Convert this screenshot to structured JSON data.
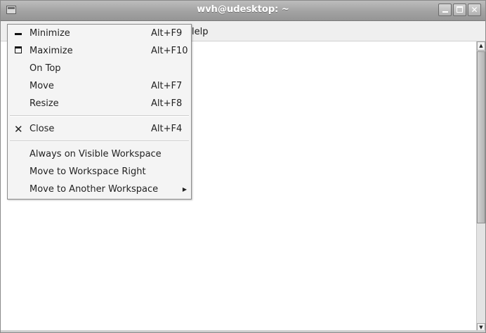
{
  "window": {
    "title": "wvh@udesktop: ~"
  },
  "menubar": {
    "visible_item": "lelp"
  },
  "window_menu": {
    "items": [
      {
        "label": "Minimize",
        "accel": "Alt+F9",
        "icon": "minimize-icon"
      },
      {
        "label": "Maximize",
        "accel": "Alt+F10",
        "icon": "maximize-icon"
      },
      {
        "label": "On Top",
        "accel": ""
      },
      {
        "label": "Move",
        "accel": "Alt+F7"
      },
      {
        "label": "Resize",
        "accel": "Alt+F8"
      },
      {
        "label": "Close",
        "accel": "Alt+F4",
        "icon": "close-icon"
      },
      {
        "label": "Always on Visible Workspace",
        "accel": ""
      },
      {
        "label": "Move to Workspace Right",
        "accel": ""
      },
      {
        "label": "Move to Another Workspace",
        "accel": "",
        "submenu": true
      }
    ]
  },
  "colors": {
    "titlebar": "#a2a2a2",
    "menu_bg": "#f4f4f4",
    "window_bg": "#ffffff"
  }
}
